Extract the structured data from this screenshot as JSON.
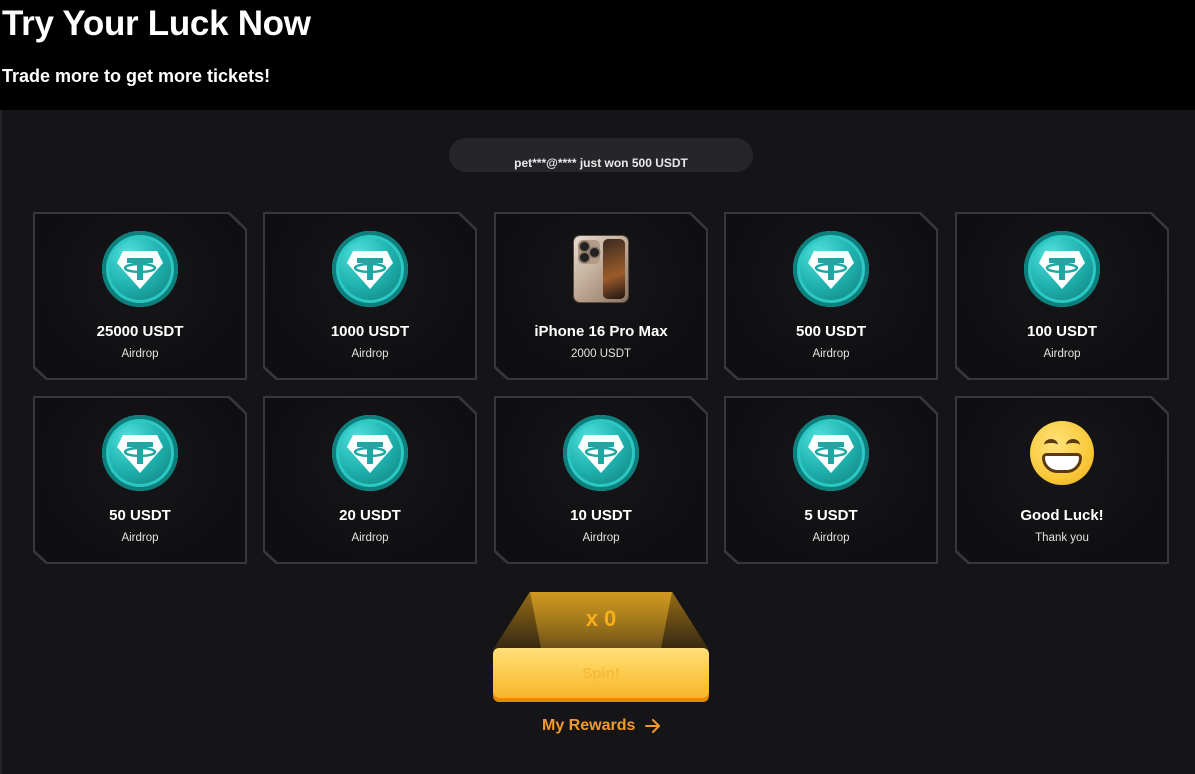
{
  "header": {
    "title": "Try Your Luck Now",
    "subtitle": "Trade more to get more tickets!"
  },
  "ticker": {
    "text": "pet***@**** just won 500 USDT"
  },
  "prizes": [
    {
      "title": "25000 USDT",
      "sub": "Airdrop",
      "icon": "usdt-coin-icon"
    },
    {
      "title": "1000 USDT",
      "sub": "Airdrop",
      "icon": "usdt-coin-icon"
    },
    {
      "title": "iPhone 16 Pro Max",
      "sub": "2000 USDT",
      "icon": "iphone-icon"
    },
    {
      "title": "500 USDT",
      "sub": "Airdrop",
      "icon": "usdt-coin-icon"
    },
    {
      "title": "100 USDT",
      "sub": "Airdrop",
      "icon": "usdt-coin-icon"
    },
    {
      "title": "50 USDT",
      "sub": "Airdrop",
      "icon": "usdt-coin-icon"
    },
    {
      "title": "20 USDT",
      "sub": "Airdrop",
      "icon": "usdt-coin-icon"
    },
    {
      "title": "10 USDT",
      "sub": "Airdrop",
      "icon": "usdt-coin-icon"
    },
    {
      "title": "5 USDT",
      "sub": "Airdrop",
      "icon": "usdt-coin-icon"
    },
    {
      "title": "Good Luck!",
      "sub": "Thank you",
      "icon": "grinning-emoji-icon"
    }
  ],
  "spin": {
    "multiplier": "x 0",
    "button_label": "Spin!"
  },
  "rewards_link": {
    "label": "My Rewards",
    "icon": "arrow-right-icon"
  },
  "colors": {
    "accent": "#f7b01c",
    "link": "#f09a2d",
    "coin": "#1fb1ad",
    "panel_bg": "#151517"
  }
}
